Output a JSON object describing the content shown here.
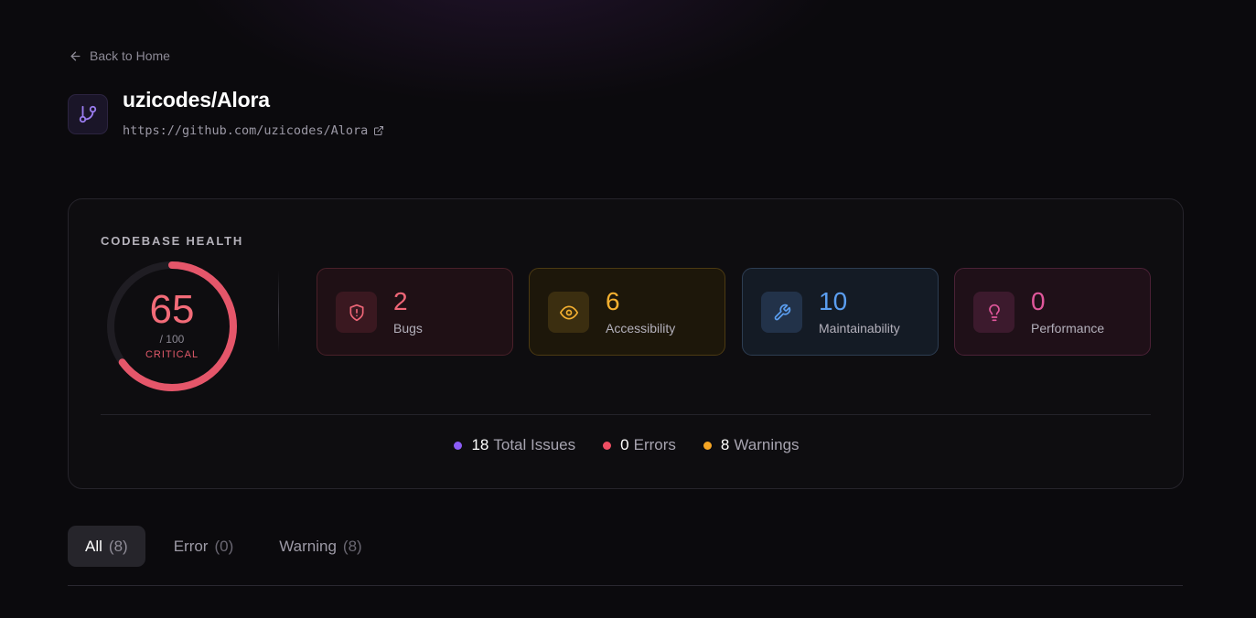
{
  "nav": {
    "back_label": "Back to Home"
  },
  "repo": {
    "title": "uzicodes/Alora",
    "url": "https://github.com/uzicodes/Alora"
  },
  "health": {
    "label": "CODEBASE HEALTH",
    "score": "65",
    "max": "/ 100",
    "status": "CRITICAL",
    "score_fraction": 0.65,
    "color": "#e5566a"
  },
  "metrics": [
    {
      "value": "2",
      "label": "Bugs",
      "icon": "shield-alert-icon",
      "color": "#ef6677"
    },
    {
      "value": "6",
      "label": "Accessibility",
      "icon": "eye-icon",
      "color": "#f4b030"
    },
    {
      "value": "10",
      "label": "Maintainability",
      "icon": "wrench-icon",
      "color": "#5b9ef0"
    },
    {
      "value": "0",
      "label": "Performance",
      "icon": "lightbulb-icon",
      "color": "#e0579b"
    }
  ],
  "summary": [
    {
      "value": "18",
      "label": "Total Issues",
      "color": "#8b5cf6"
    },
    {
      "value": "0",
      "label": "Errors",
      "color": "#ef4e63"
    },
    {
      "value": "8",
      "label": "Warnings",
      "color": "#f5a524"
    }
  ],
  "tabs": [
    {
      "label": "All",
      "count": "(8)",
      "active": true
    },
    {
      "label": "Error",
      "count": "(0)",
      "active": false
    },
    {
      "label": "Warning",
      "count": "(8)",
      "active": false
    }
  ]
}
